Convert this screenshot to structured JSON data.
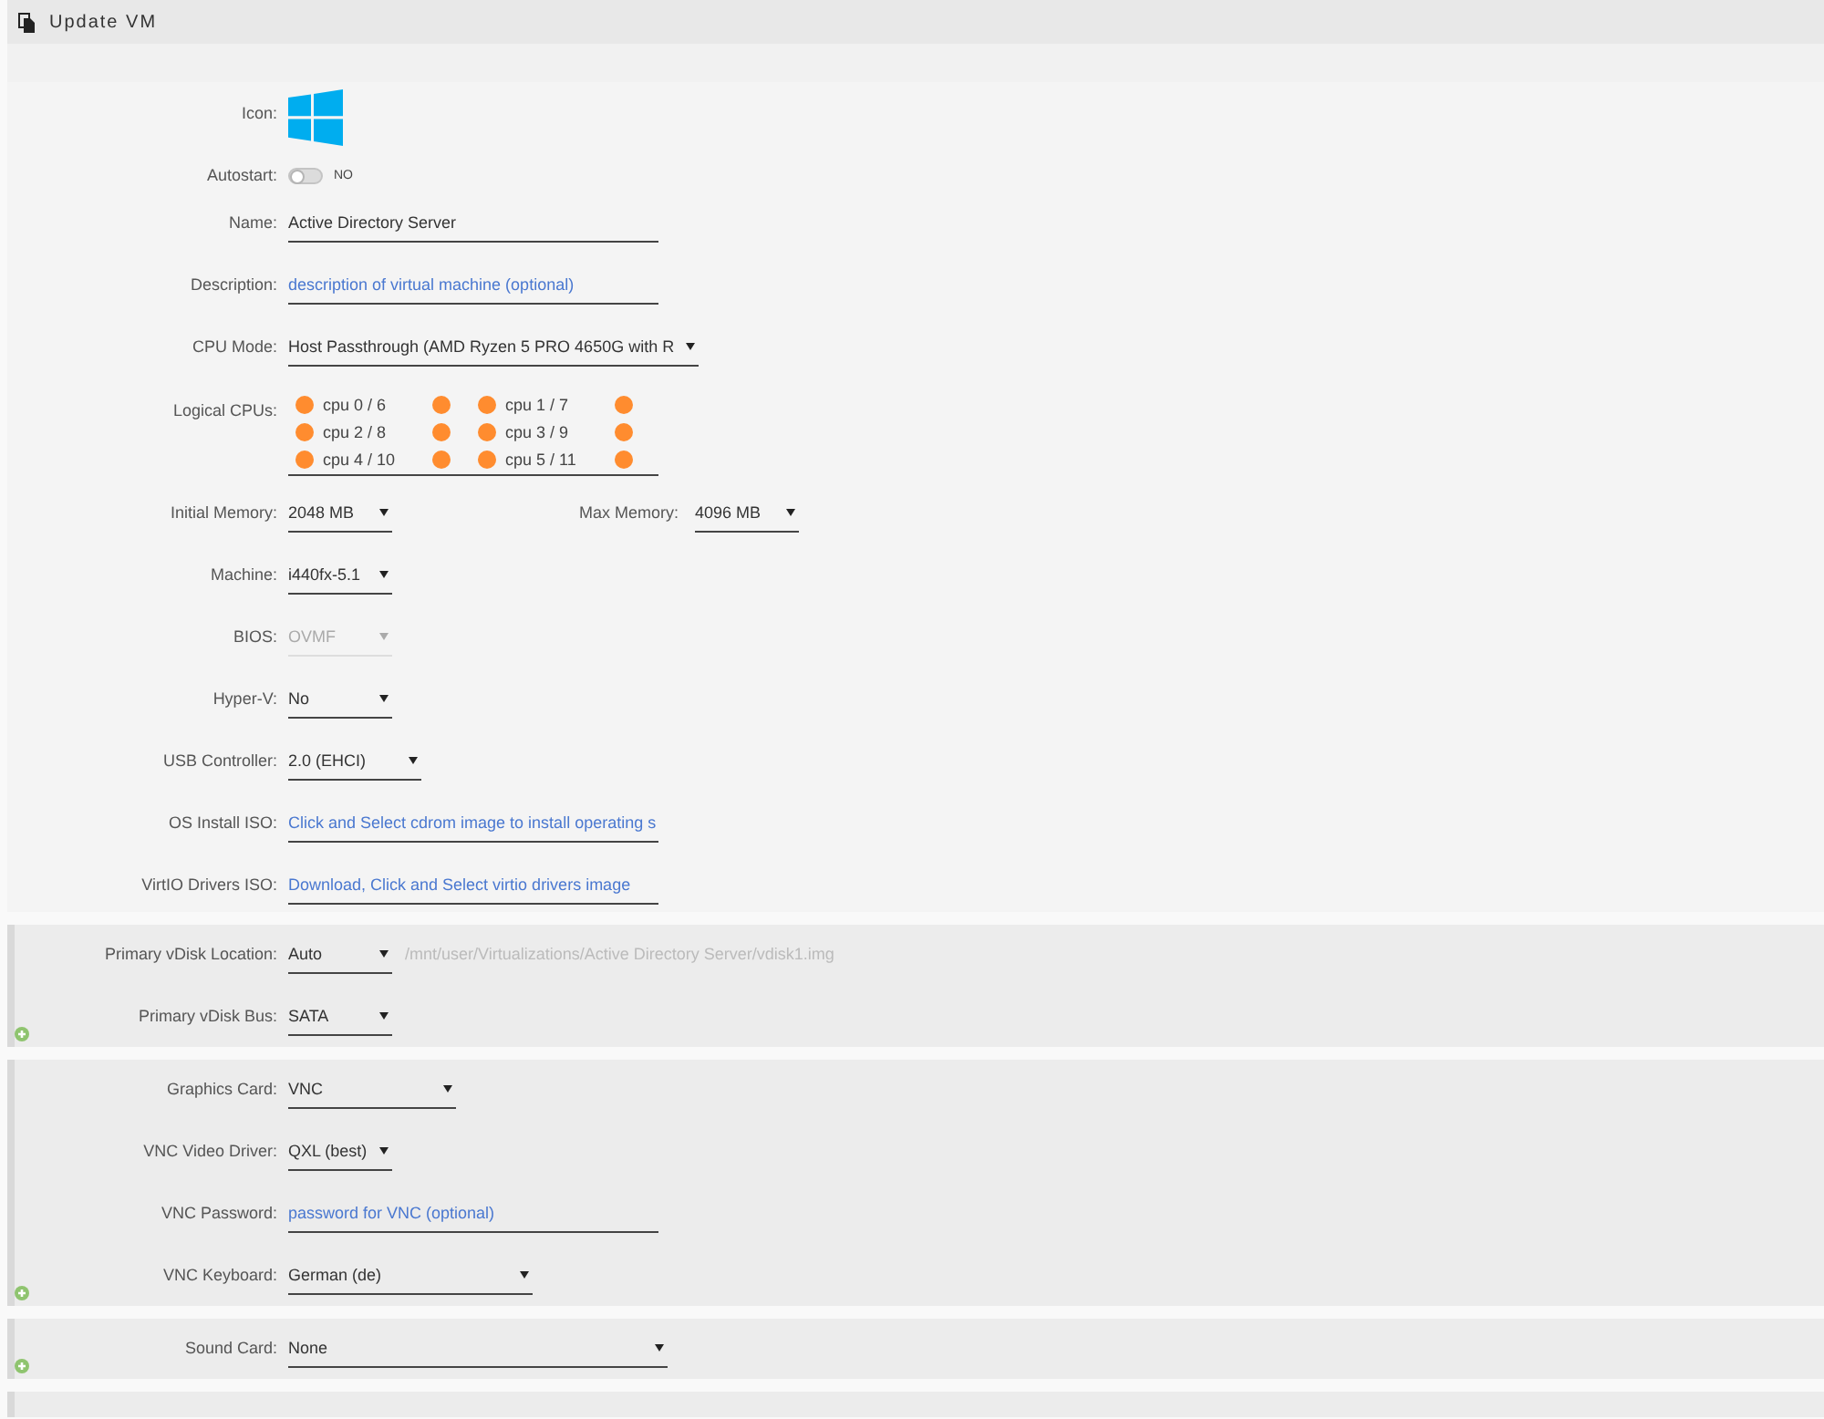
{
  "window": {
    "title": "Update VM"
  },
  "sections": [
    {
      "kind": "general",
      "fields": [
        {
          "kind": "icon",
          "label": "Icon:"
        },
        {
          "kind": "switch",
          "label": "Autostart:",
          "on": false,
          "state_text": "NO"
        },
        {
          "kind": "text",
          "label": "Name:",
          "value": "Active Directory Server"
        },
        {
          "kind": "text",
          "label": "Description:",
          "placeholder": "description of virtual machine (optional)"
        },
        {
          "kind": "select",
          "label": "CPU Mode:",
          "value": "Host Passthrough (AMD Ryzen 5 PRO 4650G with R",
          "disabled": false
        },
        {
          "kind": "cpus",
          "label": "Logical CPUs:",
          "cpus": [
            {
              "label": "cpu 0 / 6",
              "threads": [
                {
                  "checked": true
                },
                {
                  "checked": true
                }
              ]
            },
            {
              "label": "cpu 1 / 7",
              "threads": [
                {
                  "checked": true
                },
                {
                  "checked": true
                }
              ]
            },
            {
              "label": "cpu 2 / 8",
              "threads": [
                {
                  "checked": true
                },
                {
                  "checked": true
                }
              ]
            },
            {
              "label": "cpu 3 / 9",
              "threads": [
                {
                  "checked": true
                },
                {
                  "checked": true
                }
              ]
            },
            {
              "label": "cpu 4 / 10",
              "threads": [
                {
                  "checked": true
                },
                {
                  "checked": true
                }
              ]
            },
            {
              "label": "cpu 5 / 11",
              "threads": [
                {
                  "checked": true
                },
                {
                  "checked": true
                }
              ]
            }
          ]
        },
        {
          "kind": "select",
          "label": "Initial Memory:",
          "value": "2048 MB",
          "disabled": false,
          "secondary": {
            "label": "Max Memory:",
            "value": "4096 MB",
            "disabled": false
          }
        },
        {
          "kind": "select",
          "label": "Machine:",
          "value": "i440fx-5.1",
          "disabled": false
        },
        {
          "kind": "select",
          "label": "BIOS:",
          "value": "OVMF",
          "disabled": true
        },
        {
          "kind": "select",
          "label": "Hyper-V:",
          "value": "No",
          "disabled": false
        },
        {
          "kind": "select",
          "label": "USB Controller:",
          "value": "2.0 (EHCI)",
          "disabled": false
        },
        {
          "kind": "text",
          "label": "OS Install ISO:",
          "placeholder": "Click and Select cdrom image to install operating s"
        },
        {
          "kind": "text",
          "label": "VirtIO Drivers ISO:",
          "placeholder": "Download, Click and Select virtio drivers image"
        }
      ]
    },
    {
      "kind": "device",
      "fields": [
        {
          "kind": "select",
          "label": "Primary vDisk Location:",
          "value": "Auto",
          "disabled": false,
          "note": "/mnt/user/Virtualizations/Active Directory Server/vdisk1.img"
        },
        {
          "kind": "select",
          "label": "Primary vDisk Bus:",
          "value": "SATA",
          "disabled": false
        }
      ]
    },
    {
      "kind": "device",
      "fields": [
        {
          "kind": "select",
          "label": "Graphics Card:",
          "value": "VNC",
          "disabled": false
        },
        {
          "kind": "select",
          "label": "VNC Video Driver:",
          "value": "QXL (best)",
          "disabled": false
        },
        {
          "kind": "text",
          "label": "VNC Password:",
          "placeholder": "password for VNC (optional)"
        },
        {
          "kind": "select",
          "label": "VNC Keyboard:",
          "value": "German (de)",
          "disabled": false
        }
      ]
    },
    {
      "kind": "device",
      "fields": [
        {
          "kind": "select",
          "label": "Sound Card:",
          "value": "None",
          "disabled": false
        }
      ]
    }
  ]
}
